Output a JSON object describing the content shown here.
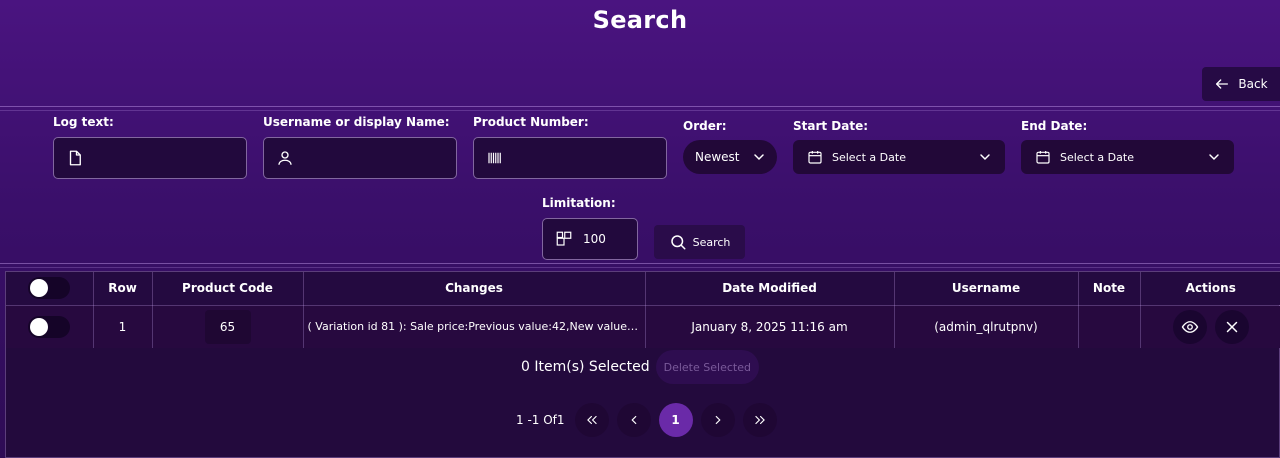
{
  "page": {
    "title": "Search"
  },
  "back_button": {
    "label": "Back"
  },
  "filters": {
    "log_text": {
      "label": "Log text:",
      "value": ""
    },
    "username": {
      "label": "Username or display Name:",
      "value": ""
    },
    "product_number": {
      "label": "Product Number:",
      "value": ""
    },
    "order": {
      "label": "Order:",
      "selected": "Newest"
    },
    "start_date": {
      "label": "Start Date:",
      "placeholder": "Select a Date"
    },
    "end_date": {
      "label": "End Date:",
      "placeholder": "Select a Date"
    },
    "limitation": {
      "label": "Limitation:",
      "value": "100"
    },
    "search_button": "Search"
  },
  "table": {
    "columns": [
      "Row",
      "Product Code",
      "Changes",
      "Date Modified",
      "Username",
      "Note",
      "Actions"
    ],
    "rows": [
      {
        "row": "1",
        "product_code": "65",
        "changes": "( Variation id 81 ): Sale price:Previous value:42,New value:…",
        "date_modified": "January 8, 2025 11:16 am",
        "username": "(admin_qlrutpnv)",
        "note": ""
      }
    ]
  },
  "selection": {
    "text": "0 Item(s) Selected",
    "delete_label": "Delete Selected"
  },
  "pagination": {
    "info": "1 -1 Of1",
    "current_page": "1"
  },
  "icons": {
    "back": "arrow-left-icon",
    "log_text": "document-icon",
    "username": "user-icon",
    "product_number": "barcode-icon",
    "date": "calendar-icon",
    "limitation": "grid-icon",
    "search": "search-icon",
    "view": "eye-icon",
    "delete": "close-icon"
  },
  "colors": {
    "background": "#3a0f6a",
    "panel": "#230a3d",
    "active_page": "#6a2aa8"
  }
}
